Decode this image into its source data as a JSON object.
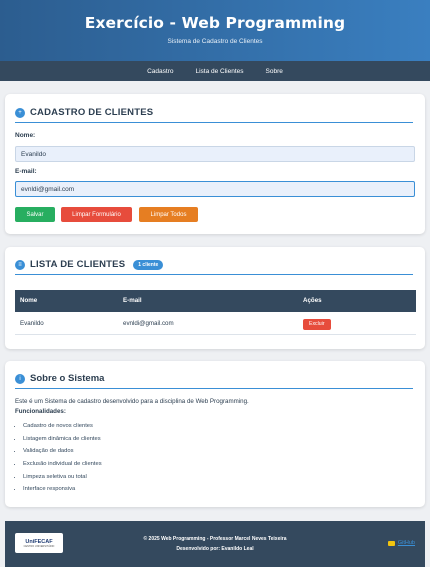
{
  "header": {
    "title": "Exercício - Web Programming",
    "subtitle": "Sistema de Cadastro de Clientes"
  },
  "nav": {
    "items": [
      "Cadastro",
      "Lista de Clientes",
      "Sobre"
    ]
  },
  "cadastro": {
    "title": "CADASTRO DE CLIENTES",
    "nome_label": "Nome:",
    "nome_value": "Evanildo",
    "email_label": "E-mail:",
    "email_value": "evnldi@gmail.com",
    "buttons": {
      "salvar": "Salvar",
      "limpar_form": "Limpar Formulário",
      "limpar_todos": "Limpar Todos"
    }
  },
  "lista": {
    "title": "LISTA DE CLIENTES",
    "badge": "1 cliente",
    "columns": [
      "Nome",
      "E-mail",
      "Ações"
    ],
    "rows": [
      {
        "nome": "Evanildo",
        "email": "evnldi@gmail.com",
        "action": "Excluir"
      }
    ]
  },
  "sobre": {
    "title": "Sobre o Sistema",
    "intro": "Este é um Sistema de cadastro desenvolvido para a disciplina de Web Programming.",
    "func_label": "Funcionalidades:",
    "features": [
      "Cadastro de novos clientes",
      "Listagem dinâmica de clientes",
      "Validação de dados",
      "Exclusão individual de clientes",
      "Limpeza seletiva ou total",
      "Interface responsiva"
    ]
  },
  "footer": {
    "logo_main": "UniFECAF",
    "logo_sub": "CENTRO UNIVERSITÁRIO",
    "line1": "© 2025 Web Programming - Professor Marcel Neves Teixeira",
    "line2": "Desenvolvido por: Evanildo Leal",
    "github": "GitHub"
  },
  "colors": {
    "accent": "#3a8fd6",
    "dark": "#34495e",
    "success": "#27ae60",
    "danger": "#e74c3c",
    "warning": "#e67e22"
  }
}
